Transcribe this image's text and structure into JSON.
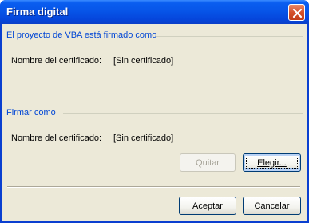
{
  "window": {
    "title": "Firma digital",
    "close_label": "Close"
  },
  "signed_group": {
    "title": "El proyecto de VBA está firmado como",
    "cert_label": "Nombre del certificado:",
    "cert_value": "[Sin certificado]"
  },
  "sign_as_group": {
    "title": "Firmar como",
    "cert_label": "Nombre del certificado:",
    "cert_value": "[Sin certificado]"
  },
  "buttons": {
    "remove": "Quitar",
    "choose": "Elegir...",
    "ok": "Aceptar",
    "cancel": "Cancelar"
  },
  "colors": {
    "titlebar": "#0755e8",
    "group_title": "#0046d5",
    "dialog_bg": "#ece9d8",
    "close_button": "#d4502a"
  }
}
